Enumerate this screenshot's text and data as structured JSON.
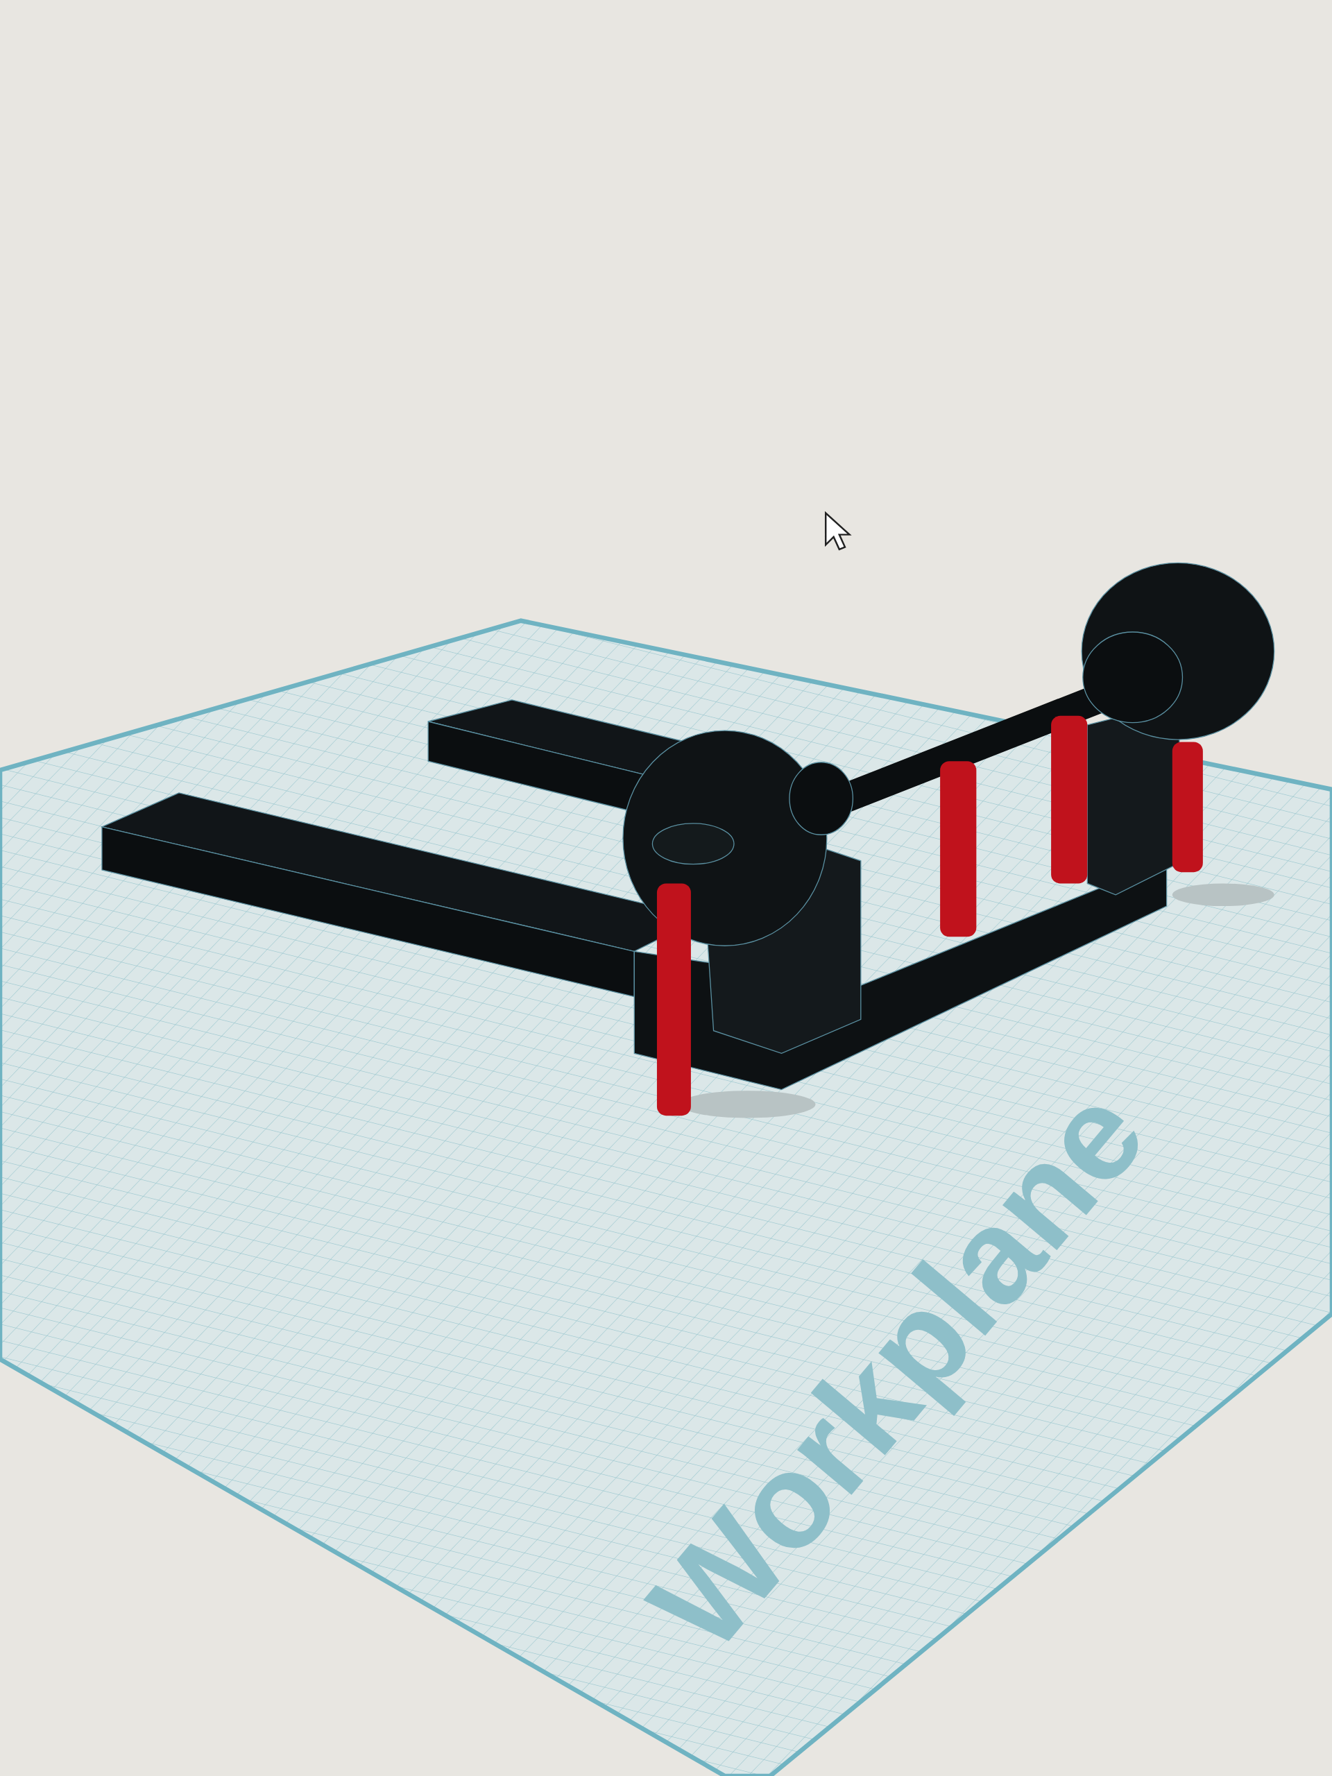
{
  "viewport": {
    "workplane_label": "Workplane"
  }
}
